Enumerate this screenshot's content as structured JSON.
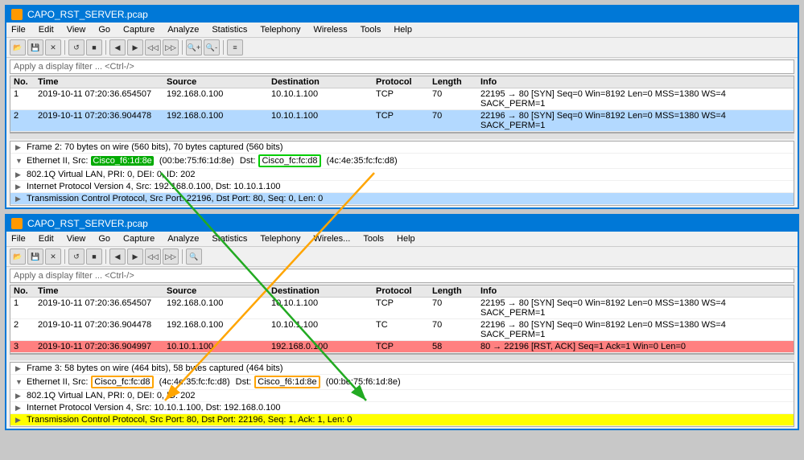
{
  "top_window": {
    "title": "CAPO_RST_SERVER.pcap",
    "menu": [
      "File",
      "Edit",
      "View",
      "Go",
      "Capture",
      "Analyze",
      "Statistics",
      "Telephony",
      "Wireless",
      "Tools",
      "Help"
    ],
    "filter_placeholder": "Apply a display filter ... <Ctrl-/>",
    "columns": [
      "No.",
      "Time",
      "Source",
      "Destination",
      "Protocol",
      "Length",
      "Info"
    ],
    "packets": [
      {
        "no": "1",
        "time": "2019-10-11 07:20:36.654507",
        "source": "192.168.0.100",
        "dest": "10.10.1.100",
        "proto": "TCP",
        "len": "70",
        "info": "22195 → 80 [SYN] Seq=0 Win=8192 Len=0 MSS=1380 WS=4 SACK_PERM=1"
      },
      {
        "no": "2",
        "time": "2019-10-11 07:20:36.904478",
        "source": "192.168.0.100",
        "dest": "10.10.1.100",
        "proto": "TCP",
        "len": "70",
        "info": "22196 → 80 [SYN] Seq=0 Win=8192 Len=0 MSS=1380 WS=4 SACK_PERM=1"
      }
    ],
    "details": [
      {
        "text": "Frame 2: 70 bytes on wire (560 bits), 70 bytes captured (560 bits)",
        "indent": 0,
        "type": "normal"
      },
      {
        "text": "Ethernet II, Src: ",
        "src_label": "Cisco_f6:1d:8e",
        "src_val": "(00:be:75:f6:1d:8e)",
        "dst_label": "Cisco_fc:fc:d8",
        "dst_val": "(4c:4e:35:fc:fc:d8)",
        "indent": 0,
        "type": "ethernet"
      },
      {
        "text": "802.1Q Virtual LAN, PRI: 0, DEI: 0, ID: 202",
        "indent": 0,
        "type": "normal"
      },
      {
        "text": "Internet Protocol Version 4, Src: 192.168.0.100, Dst: 10.10.1.100",
        "indent": 0,
        "type": "normal"
      },
      {
        "text": "Transmission Control Protocol, Src Port: 22196, Dst Port: 80, Seq: 0, Len: 0",
        "indent": 0,
        "type": "selected"
      }
    ]
  },
  "bottom_window": {
    "title": "CAPO_RST_SERVER.pcap",
    "menu": [
      "File",
      "Edit",
      "View",
      "Go",
      "Capture",
      "Analyze",
      "Statistics",
      "Telephony",
      "Wireless",
      "Tools",
      "Help"
    ],
    "filter_placeholder": "Apply a display filter ... <Ctrl-/>",
    "columns": [
      "No.",
      "Time",
      "Source",
      "Destination",
      "Protocol",
      "Length",
      "Info"
    ],
    "packets": [
      {
        "no": "1",
        "time": "2019-10-11 07:20:36.654507",
        "source": "192.168.0.100",
        "dest": "10.10.1.100",
        "proto": "TCP",
        "len": "70",
        "info": "22195 → 80 [SYN] Seq=0 Win=8192 Len=0 MSS=1380 WS=4 SACK_PERM=1"
      },
      {
        "no": "2",
        "time": "2019-10-11 07:20:36.904478",
        "source": "192.168.0.100",
        "dest": "10.10.1.100",
        "proto": "TC",
        "len": "70",
        "info": "22196 → 80 [SYN] Seq=0 Win=8192 Len=0 MSS=1380 WS=4 SACK_PERM=1"
      },
      {
        "no": "3",
        "time": "2019-10-11 07:20:36.904997",
        "source": "10.10.1.100",
        "dest": "192.168.0.100",
        "proto": "TCP",
        "len": "58",
        "info": "80 → 22196 [RST, ACK] Seq=1 Ack=1 Win=0 Len=0"
      }
    ],
    "details": [
      {
        "text": "Frame 3: 58 bytes on wire (464 bits), 58 bytes captured (464 bits)",
        "indent": 0,
        "type": "normal"
      },
      {
        "text": "Ethernet II, Src: ",
        "src_label": "Cisco_fc:fc:d8",
        "src_val": "(4c:4e:35:fc:fc:d8)",
        "dst_label": "Cisco_f6:1d:8e",
        "dst_val": "(00:be:75:f6:1d:8e)",
        "indent": 0,
        "type": "ethernet"
      },
      {
        "text": "802.1Q Virtual LAN, PRI: 0, DEI: 0, ID: 202",
        "indent": 0,
        "type": "normal"
      },
      {
        "text": "Internet Protocol Version 4, Src: 10.10.1.100, Dst: 192.168.0.100",
        "indent": 0,
        "type": "normal"
      },
      {
        "text": "Transmission Control Protocol, Src Port: 80, Dst Port: 22196, Seq: 1, Ack: 1, Len: 0",
        "indent": 0,
        "type": "yellow"
      }
    ]
  },
  "labels": {
    "ethernet_top": "Ethernet",
    "ethernet_bottom": "Ethernet",
    "no": "No.",
    "time": "Time",
    "source": "Source",
    "destination": "Destination",
    "protocol": "Protocol",
    "length": "Length",
    "info": "Info"
  }
}
